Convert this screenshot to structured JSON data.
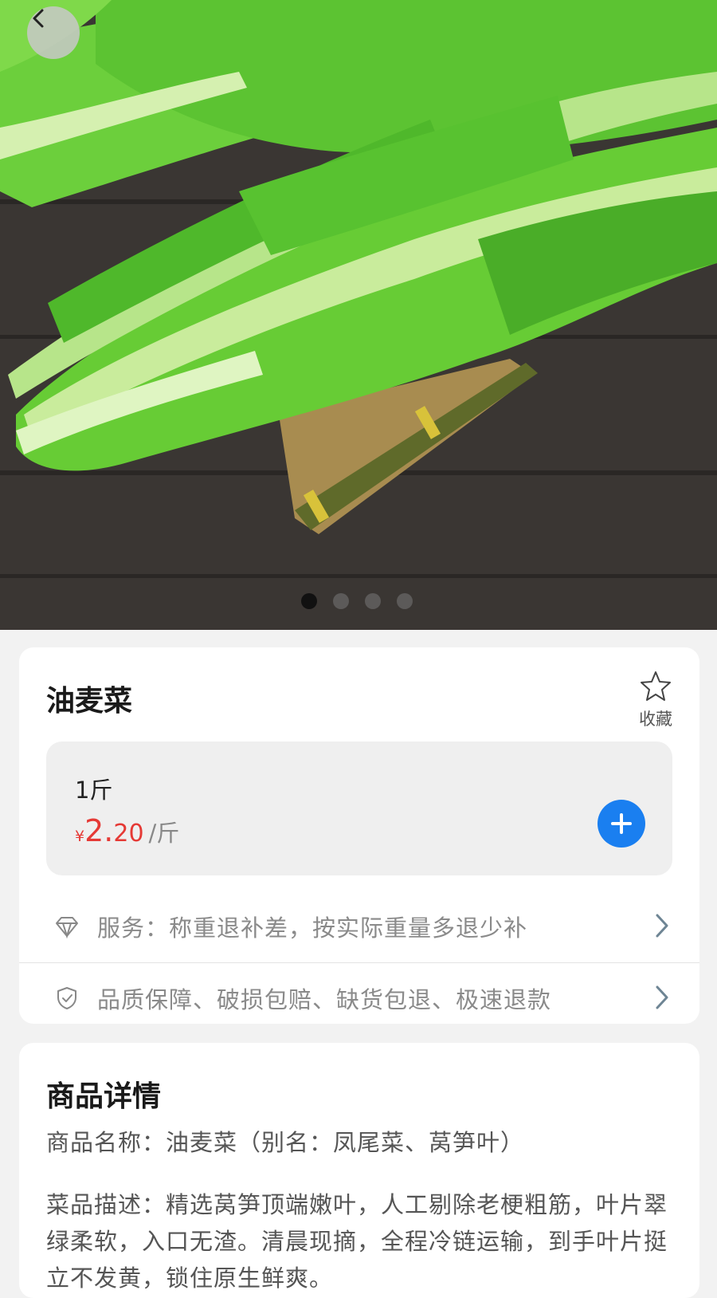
{
  "hero": {
    "image_description": "lettuce-photo",
    "dots_total": 4,
    "dots_active_index": 0
  },
  "product": {
    "name": "油麦菜",
    "favorite_label": "收藏",
    "sku": {
      "spec": "1斤",
      "currency_symbol": "¥",
      "price_integer": "2.",
      "price_decimal": "20",
      "unit": "/斤"
    },
    "service_row": "服务：称重退补差，按实际重量多退少补",
    "guarantee_row": "品质保障、破损包赔、缺货包退、极速退款"
  },
  "details": {
    "title": "商品详情",
    "name_line": "商品名称：油麦菜（别名：凤尾菜、莴笋叶）",
    "description": "菜品描述：精选莴笋顶端嫩叶，人工剔除老梗粗筋，叶片翠绿柔软，入口无渣。清晨现摘，全程冷链运输，到手叶片挺立不发黄，锁住原生鲜爽。"
  },
  "colors": {
    "accent_blue": "#1a7ff0",
    "price_red": "#e53935"
  }
}
